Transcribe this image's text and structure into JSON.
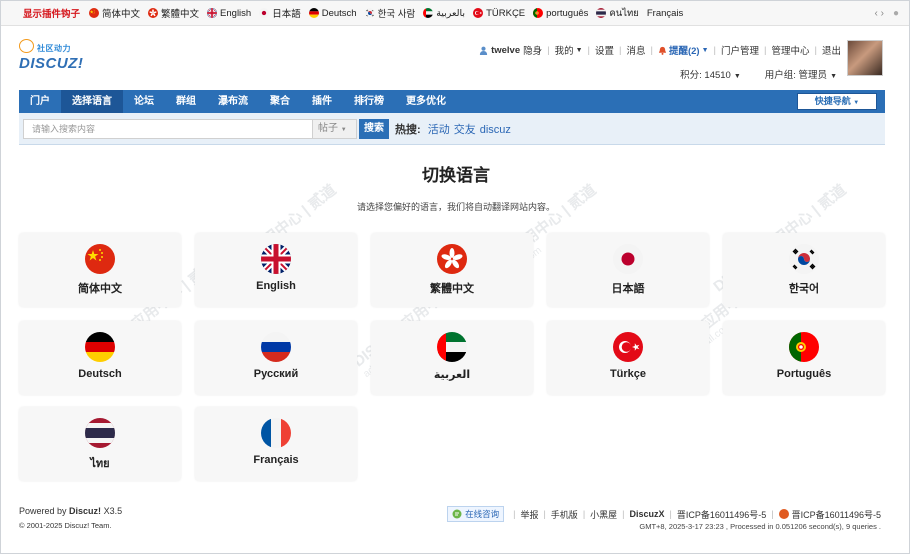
{
  "langbar": {
    "highlight": "显示插件钩子",
    "items": [
      {
        "label": "简体中文",
        "flag": "cn"
      },
      {
        "label": "繁體中文",
        "flag": "hk"
      },
      {
        "label": "English",
        "flag": "gb"
      },
      {
        "label": "日本語",
        "flag": "jp"
      },
      {
        "label": "Deutsch",
        "flag": "de"
      },
      {
        "label": "한국 사람",
        "flag": "kr"
      },
      {
        "label": "بالعربية",
        "flag": "ae"
      },
      {
        "label": "TÜRKÇE",
        "flag": "tr"
      },
      {
        "label": "português",
        "flag": "pt"
      },
      {
        "label": "คนไทย",
        "flag": "th"
      },
      {
        "label": "Français",
        "flag": "none"
      }
    ],
    "right_icons": [
      "code-icon",
      "palette-icon"
    ],
    "code_glyph": "‹ ›",
    "palette_glyph": "●"
  },
  "logo": {
    "cn": "社区动力",
    "en": "DISCUZ!"
  },
  "user": {
    "name": "twelve",
    "status": "隐身",
    "mine": "我的",
    "settings": "设置",
    "messages": "消息",
    "remind": "提醒(2)",
    "portal_admin": "门户管理",
    "admin_center": "管理中心",
    "logout": "退出",
    "points": "积分: 14510",
    "group": "用户组: 管理员"
  },
  "nav": {
    "items": [
      "门户",
      "选择语言",
      "论坛",
      "群组",
      "瀑布流",
      "聚合",
      "插件",
      "排行榜",
      "更多优化"
    ],
    "active_index": 1,
    "quick": "快捷导航"
  },
  "search": {
    "placeholder": "请输入搜索内容",
    "type": "帖子",
    "button": "搜索",
    "hot_label": "热搜:",
    "hot": [
      "活动",
      "交友",
      "discuz"
    ]
  },
  "main": {
    "title": "切换语言",
    "subtitle": "请选择您偏好的语言，我们将自动翻译网站内容。",
    "languages": [
      {
        "name": "简体中文",
        "flag": "cn"
      },
      {
        "name": "English",
        "flag": "gb"
      },
      {
        "name": "繁體中文",
        "flag": "hk"
      },
      {
        "name": "日本語",
        "flag": "jp"
      },
      {
        "name": "한국어",
        "flag": "kr"
      },
      {
        "name": "Deutsch",
        "flag": "de"
      },
      {
        "name": "Русский",
        "flag": "ru"
      },
      {
        "name": "العربية",
        "flag": "ae"
      },
      {
        "name": "Türkçe",
        "flag": "tr"
      },
      {
        "name": "Português",
        "flag": "pt"
      },
      {
        "name": "ไทย",
        "flag": "th"
      },
      {
        "name": "Français",
        "flag": "fr"
      }
    ]
  },
  "watermark": {
    "line1": "DISCUZ!应用中心 | 贰道",
    "line2": "addon.dismall.com"
  },
  "footer": {
    "powered": "Powered by",
    "brand": "Discuz!",
    "version": "X3.5",
    "copyright": "© 2001-2025 Discuz! Team.",
    "consult": "在线咨询",
    "links": [
      "举报",
      "手机版",
      "小黑屋",
      "DiscuzX",
      "晋ICP备16011496号-5",
      "晋ICP备16011496号-5"
    ],
    "stats": "GMT+8, 2025-3-17 23:23 , Processed in 0.051206 second(s), 9 queries ."
  }
}
